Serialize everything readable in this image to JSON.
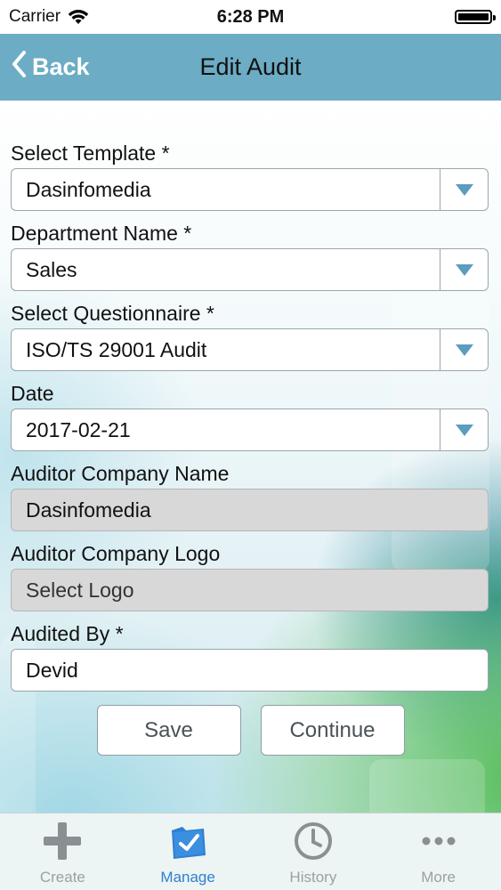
{
  "status_bar": {
    "carrier": "Carrier",
    "time": "6:28 PM"
  },
  "nav": {
    "back_label": "Back",
    "title": "Edit Audit"
  },
  "form": {
    "select_template": {
      "label": "Select Template *",
      "value": "Dasinfomedia"
    },
    "department_name": {
      "label": "Department Name *",
      "value": "Sales"
    },
    "select_questionnaire": {
      "label": "Select Questionnaire *",
      "value": "ISO/TS 29001 Audit"
    },
    "date": {
      "label": "Date",
      "value": "2017-02-21"
    },
    "auditor_company_name": {
      "label": "Auditor Company Name",
      "value": "Dasinfomedia"
    },
    "auditor_company_logo": {
      "label": "Auditor Company Logo",
      "value": "Select Logo"
    },
    "audited_by": {
      "label": "Audited By *",
      "value": "Devid"
    }
  },
  "actions": {
    "save_label": "Save",
    "continue_label": "Continue"
  },
  "tabs": [
    {
      "label": "Create",
      "icon": "plus-icon"
    },
    {
      "label": "Manage",
      "icon": "manage-check-icon",
      "active": true
    },
    {
      "label": "History",
      "icon": "clock-icon"
    },
    {
      "label": "More",
      "icon": "more-dots-icon"
    }
  ],
  "colors": {
    "nav_bar": "#6cacc4",
    "accent_blue": "#2f7fcf",
    "dropdown_arrow": "#5a9dbf"
  }
}
